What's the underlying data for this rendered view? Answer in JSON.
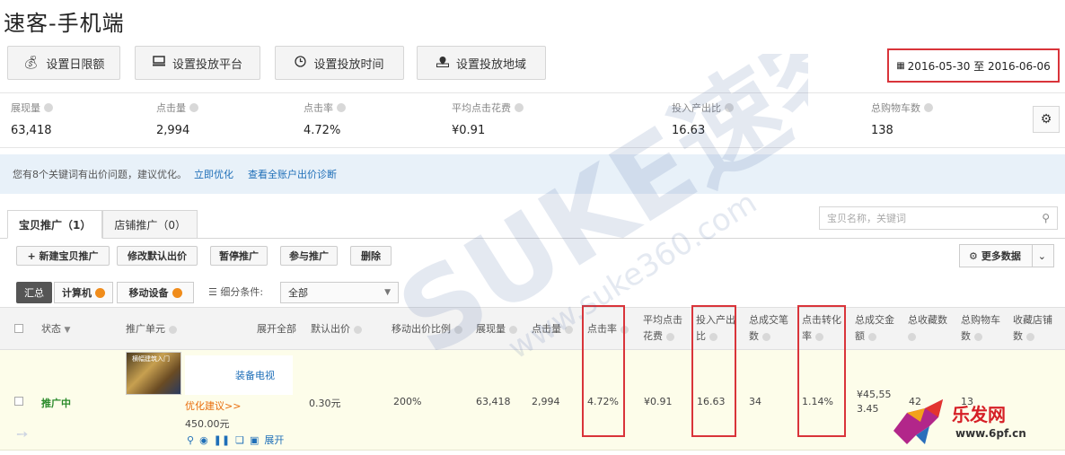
{
  "header": {
    "title": "速客-手机端"
  },
  "settings": {
    "daily_limit": "设置日限额",
    "platform": "设置投放平台",
    "time": "设置投放时间",
    "region": "设置投放地域"
  },
  "date_range": "2016-05-30 至 2016-06-06",
  "metrics": [
    {
      "label": "展现量",
      "value": "63,418"
    },
    {
      "label": "点击量",
      "value": "2,994"
    },
    {
      "label": "点击率",
      "value": "4.72%"
    },
    {
      "label": "平均点击花费",
      "value": "¥0.91"
    },
    {
      "label": "投入产出比",
      "value": "16.63"
    },
    {
      "label": "总购物车数",
      "value": "138"
    }
  ],
  "notice": {
    "text": "您有8个关键词有出价问题，建议优化。",
    "link1": "立即优化",
    "link2": "查看全账户出价诊断"
  },
  "tabs": [
    {
      "label": "宝贝推广（1）"
    },
    {
      "label": "店铺推广（0）"
    }
  ],
  "search": {
    "placeholder": "宝贝名称，关键词"
  },
  "actions": {
    "new": "+ 新建宝贝推广",
    "modify_bid": "修改默认出价",
    "pause": "暂停推广",
    "join": "参与推广",
    "delete": "删除",
    "more": "更多数据"
  },
  "segments": {
    "all": "汇总",
    "pc": "计算机",
    "mobile": "移动设备"
  },
  "filter": {
    "label": "细分条件:",
    "value": "全部"
  },
  "columns": {
    "status": "状态",
    "unit": "推广单元",
    "expand_all": "展开全部",
    "default_bid": "默认出价",
    "mobile_ratio": "移动出价比例",
    "impressions": "展现量",
    "clicks": "点击量",
    "ctr": "点击率",
    "avg_cpc_1": "平均点击",
    "avg_cpc_2": "花费",
    "roi_1": "投入产出",
    "roi_2": "比",
    "deals_1": "总成交笔",
    "deals_2": "数",
    "cvr_1": "点击转化",
    "cvr_2": "率",
    "amount_1": "总成交金",
    "amount_2": "额",
    "favs": "总收藏数",
    "cart_1": "总购物车",
    "cart_2": "数",
    "shopfav_1": "收藏店铺",
    "shopfav_2": "数"
  },
  "row": {
    "status": "推广中",
    "thumb_text": "横幅建筑入门",
    "name_tail": "装备电视",
    "suggest": "优化建议>>",
    "price": "450.00元",
    "expand": "展开",
    "default_bid": "0.30元",
    "mobile_ratio": "200%",
    "impressions": "63,418",
    "clicks": "2,994",
    "ctr": "4.72%",
    "avg_cpc": "¥0.91",
    "roi": "16.63",
    "deals": "34",
    "cvr": "1.14%",
    "amount_1": "¥45,55",
    "amount_2": "3.45",
    "favs": "42",
    "cart": "13"
  },
  "watermark": {
    "brand": "SUKE速客",
    "url": "www.suke360.com"
  },
  "corner_logo": {
    "name": "乐发网",
    "url": "www.6pf.cn"
  }
}
